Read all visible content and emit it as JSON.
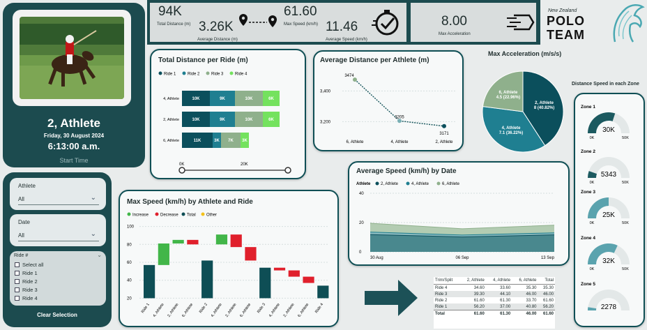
{
  "profile": {
    "athlete_name": "2, Athlete",
    "date": "Friday, 30 August 2024",
    "time": "6:13:00 a.m.",
    "start_label": "Start Time"
  },
  "filters": {
    "athlete": {
      "label": "Athlete",
      "value": "All"
    },
    "date": {
      "label": "Date",
      "value": "All"
    },
    "ride": {
      "label": "Ride #",
      "options": [
        "Select all",
        "Ride 1",
        "Ride 2",
        "Ride 3",
        "Ride 4"
      ]
    },
    "clear_label": "Clear Selection"
  },
  "kpis": {
    "total_distance": {
      "value": "94K",
      "label": "Total Distance (m)"
    },
    "average_distance": {
      "value": "3.26K",
      "label": "Average Distance (m)"
    },
    "max_speed": {
      "value": "61.60",
      "label": "Max Speed (km/h)"
    },
    "average_speed": {
      "value": "11.46",
      "label": "Average Speed (km/h)"
    },
    "max_acceleration": {
      "value": "8.00",
      "label": "Max Acceleration"
    }
  },
  "logo": {
    "line1": "New Zealand",
    "line2": "POLO",
    "line3": "TEAM"
  },
  "colors": {
    "ride1": "#0b4f5c",
    "ride2": "#1f7f91",
    "ride3": "#8fb08c",
    "ride4": "#74e25e",
    "dark": "#1c4b4f",
    "increase": "#42b649",
    "decrease": "#e0202c",
    "total": "#0e4e55",
    "other": "#f4c21b"
  },
  "total_distance_chart": {
    "title": "Total Distance per Ride (m)",
    "legend": [
      "Ride 1",
      "Ride 2",
      "Ride 3",
      "Ride 4"
    ],
    "slider": {
      "min_label": "0K",
      "mid_label": "20K"
    },
    "chart_data": {
      "type": "bar",
      "categories": [
        "4, Athlete",
        "2, Athlete",
        "6, Athlete"
      ],
      "series": [
        {
          "name": "Ride 1",
          "values": [
            10000,
            10000,
            11000
          ],
          "labels": [
            "10K",
            "10K",
            "11K"
          ]
        },
        {
          "name": "Ride 2",
          "values": [
            9000,
            9000,
            3000
          ],
          "labels": [
            "9K",
            "9K",
            "3K"
          ]
        },
        {
          "name": "Ride 3",
          "values": [
            10000,
            10000,
            7000
          ],
          "labels": [
            "10K",
            "10K",
            "7K"
          ]
        },
        {
          "name": "Ride 4",
          "values": [
            6000,
            6000,
            3000
          ],
          "labels": [
            "6K",
            "6K",
            "3K"
          ]
        }
      ],
      "stacked": true,
      "orientation": "horizontal"
    }
  },
  "avg_distance_chart": {
    "title": "Average Distance per Athlete (m)",
    "chart_data": {
      "type": "line",
      "categories": [
        "6, Athlete",
        "4, Athlete",
        "2, Athlete"
      ],
      "values": [
        3474,
        3205,
        3171
      ],
      "labels": [
        "3474",
        "3205",
        "3171"
      ],
      "y_ticks": [
        "3,400",
        "3,200"
      ],
      "ylim": [
        3120,
        3520
      ]
    }
  },
  "max_accel_chart": {
    "title": "Max Acceleration (m/s/s)",
    "chart_data": {
      "type": "pie",
      "slices": [
        {
          "label": "2, Athlete",
          "value": 8,
          "pct": "8 (40.82%)"
        },
        {
          "label": "4, Athlete",
          "value": 7.1,
          "pct": "7.1 (36.22%)"
        },
        {
          "label": "6, Athlete",
          "value": 4.5,
          "pct": "4.5 (22.96%)"
        }
      ]
    }
  },
  "avg_speed_chart": {
    "title": "Average Speed (km/h) by Date",
    "legend_title": "Athlete",
    "legend": [
      "2, Athlete",
      "4, Athlete",
      "6, Athlete"
    ],
    "chart_data": {
      "type": "area",
      "x": [
        "30 Aug",
        "06 Sep",
        "13 Sep"
      ],
      "series": [
        {
          "name": "2, Athlete",
          "values": [
            11.8,
            10.2,
            11.6
          ]
        },
        {
          "name": "4, Athlete",
          "values": [
            13.5,
            11.5,
            13.0
          ]
        },
        {
          "name": "6, Athlete",
          "values": [
            19.5,
            15.8,
            18.2
          ]
        }
      ],
      "y_ticks": [
        "40",
        "20",
        "0"
      ],
      "ylim": [
        0,
        40
      ]
    }
  },
  "waterfall_chart": {
    "title": "Max Speed (km/h) by Athlete and Ride",
    "legend": [
      "Increase",
      "Decrease",
      "Total",
      "Other"
    ],
    "chart_data": {
      "type": "bar",
      "subtype": "waterfall",
      "categories": [
        "Ride 1",
        "4, Athlete",
        "2, Athlete",
        "6, Athlete",
        "Ride 2",
        "4, Athlete",
        "2, Athlete",
        "6, Athlete",
        "Ride 3",
        "4, Athlete",
        "2, Athlete",
        "6, Athlete",
        "Ride 4"
      ],
      "bars": [
        {
          "kind": "total",
          "from": 20,
          "to": 57
        },
        {
          "kind": "increase",
          "from": 57,
          "to": 81
        },
        {
          "kind": "increase",
          "from": 81,
          "to": 85
        },
        {
          "kind": "decrease",
          "from": 85,
          "to": 80
        },
        {
          "kind": "total",
          "from": 20,
          "to": 62
        },
        {
          "kind": "increase",
          "from": 80,
          "to": 91
        },
        {
          "kind": "decrease",
          "from": 91,
          "to": 77
        },
        {
          "kind": "decrease",
          "from": 77,
          "to": 62
        },
        {
          "kind": "total",
          "from": 20,
          "to": 54
        },
        {
          "kind": "decrease",
          "from": 54,
          "to": 51
        },
        {
          "kind": "decrease",
          "from": 51,
          "to": 44
        },
        {
          "kind": "decrease",
          "from": 44,
          "to": 37
        },
        {
          "kind": "total",
          "from": 20,
          "to": 34
        }
      ],
      "y_ticks": [
        "100",
        "80",
        "60",
        "40",
        "20"
      ],
      "ylim": [
        18,
        102
      ]
    }
  },
  "zones": {
    "title": "Distance Speed in each Zone",
    "items": [
      {
        "name": "Zone 1",
        "value": "30K",
        "fraction": 0.6,
        "min": "0K",
        "max": "50K"
      },
      {
        "name": "Zone 2",
        "value": "5343",
        "fraction": 0.107,
        "min": "0K",
        "max": "50K"
      },
      {
        "name": "Zone 3",
        "value": "25K",
        "fraction": 0.5,
        "min": "0K",
        "max": "50K"
      },
      {
        "name": "Zone 4",
        "value": "32K",
        "fraction": 0.64,
        "min": "0K",
        "max": "50K"
      },
      {
        "name": "Zone 5",
        "value": "2278",
        "fraction": 0.05,
        "min": "",
        "max": ""
      }
    ]
  },
  "speed_table": {
    "headers": [
      "Trim/Split",
      "2, Athlete",
      "4, Athlete",
      "6, Athlete",
      "Total"
    ],
    "rows": [
      [
        "Ride 4",
        "34.60",
        "33.60",
        "35.30",
        "35.30"
      ],
      [
        "Ride 3",
        "39.30",
        "44.10",
        "46.00",
        "46.00"
      ],
      [
        "Ride 2",
        "61.60",
        "61.30",
        "33.70",
        "61.60"
      ],
      [
        "Ride 1",
        "56.20",
        "37.00",
        "40.80",
        "56.20"
      ]
    ],
    "total": [
      "Total",
      "61.60",
      "61.30",
      "46.00",
      "61.60"
    ]
  }
}
